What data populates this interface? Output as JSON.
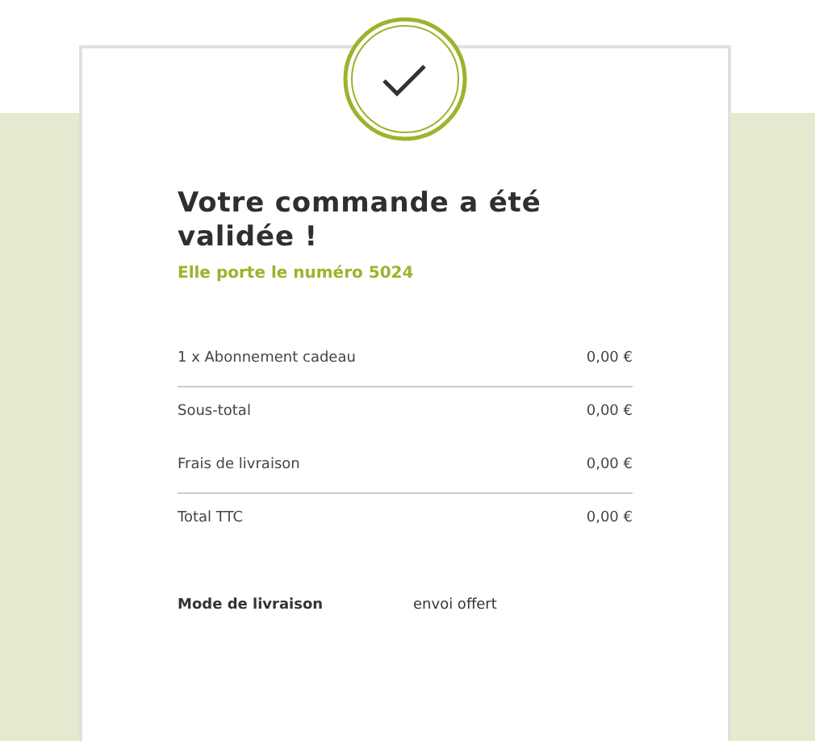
{
  "confirmation": {
    "title": "Votre commande a été validée !",
    "subtitle": "Elle porte le numéro 5024"
  },
  "order_lines": [
    {
      "label": "1 x Abonnement cadeau",
      "amount": "0,00 €",
      "divider_below": true
    },
    {
      "label": "Sous-total",
      "amount": "0,00 €",
      "divider_below": false
    },
    {
      "label": "Frais de livraison",
      "amount": "0,00 €",
      "divider_below": true
    },
    {
      "label": "Total TTC",
      "amount": "0,00 €",
      "divider_below": false
    }
  ],
  "delivery": {
    "label": "Mode de livraison",
    "value": "envoi offert"
  }
}
